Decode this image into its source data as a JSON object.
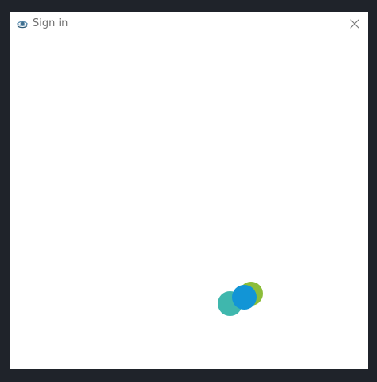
{
  "window": {
    "title": "Sign in",
    "app_icon": "eye-logo-icon",
    "close_icon": "close-icon"
  },
  "spinner": {
    "dots": [
      {
        "name": "teal",
        "color": "#3fb7ad"
      },
      {
        "name": "green",
        "color": "#8cbd3a"
      },
      {
        "name": "blue",
        "color": "#1295d6"
      }
    ]
  },
  "colors": {
    "frame_background": "#1f232a",
    "dialog_background": "#ffffff",
    "title_text": "#6f6f6f",
    "close_icon": "#7a7a7a",
    "app_icon_primary": "#3f6f8f"
  }
}
